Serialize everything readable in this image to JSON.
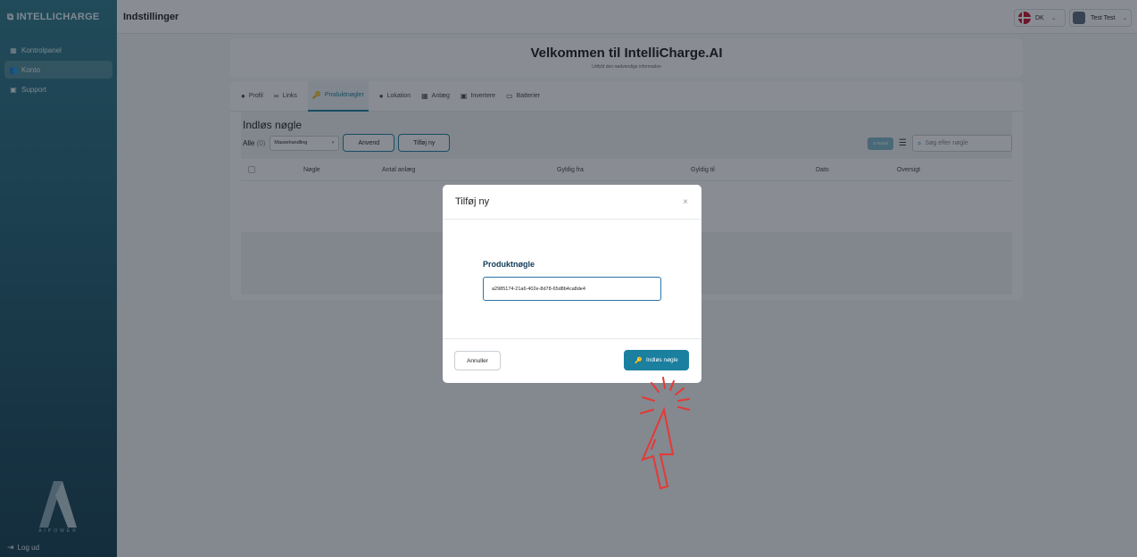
{
  "sidebar": {
    "brand": "INTELLICHARGE",
    "items": [
      {
        "label": "Kontrolpanel",
        "icon": "dashboard-icon"
      },
      {
        "label": "Konto",
        "icon": "users-icon"
      },
      {
        "label": "Support",
        "icon": "support-icon"
      }
    ],
    "logo_text": "AIPOWER",
    "logout": "Log ud"
  },
  "topbar": {
    "title": "Indstillinger",
    "language": "DK",
    "user": "Test Test"
  },
  "welcome": {
    "title": "Velkommen til IntelliCharge.AI",
    "subtitle": "Udfyld den nødvendige information"
  },
  "tabs": [
    {
      "label": "Profil",
      "icon": "user-circle-icon"
    },
    {
      "label": "Links",
      "icon": "link-icon"
    },
    {
      "label": "Produktnøgler",
      "icon": "key-icon",
      "active": true
    },
    {
      "label": "Lokation",
      "icon": "location-pin-icon"
    },
    {
      "label": "Anlæg",
      "icon": "grid-icon"
    },
    {
      "label": "Invertere",
      "icon": "inverter-icon"
    },
    {
      "label": "Batterier",
      "icon": "battery-icon"
    }
  ],
  "keys": {
    "heading": "Indløs nøgle",
    "all_label": "Alle",
    "all_count": "(0)",
    "bulk_action": "Massehandling",
    "apply": "Anvend",
    "add_new": "Tilføj ny",
    "reset": "Nulstil",
    "search_placeholder": "Søg efter nøgle",
    "columns": [
      "Nøgle",
      "Antal anlæg",
      "Gyldig fra",
      "Gyldig til",
      "Dato",
      "Oversigt"
    ]
  },
  "modal": {
    "title": "Tilføj ny",
    "close": "×",
    "field_label": "Produktnøgle",
    "field_value": "a2985174-21a6-402e-8d78-65d8b4ca8de4",
    "cancel": "Annuller",
    "submit": "Indløs nøgle"
  },
  "colors": {
    "accent": "#1b7fa0",
    "annotation": "#e53935"
  }
}
